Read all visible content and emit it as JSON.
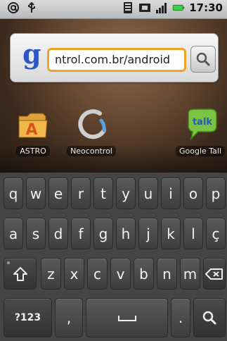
{
  "status_bar": {
    "left_icons": [
      "at-sign-icon",
      "usb-icon"
    ],
    "right_icons": [
      "sd-card-icon",
      "sim-icon",
      "signal-icon",
      "battery-icon"
    ],
    "time": "17:30"
  },
  "search": {
    "logo": "g",
    "query": "ntrol.com.br/android",
    "button_icon": "magnifier-icon"
  },
  "apps": [
    {
      "label": "ASTRO"
    },
    {
      "label": "Neocontrol"
    },
    {
      "label": "Google Tall"
    }
  ],
  "keyboard": {
    "row1": [
      "q",
      "w",
      "e",
      "r",
      "t",
      "y",
      "u",
      "i",
      "o",
      "p"
    ],
    "row2": [
      "a",
      "s",
      "d",
      "f",
      "g",
      "h",
      "j",
      "k",
      "l",
      "ç"
    ],
    "row3": [
      "z",
      "x",
      "c",
      "v",
      "b",
      "n",
      "m"
    ],
    "symbols_label": "?123",
    "comma": ",",
    "period": "."
  },
  "colors": {
    "accent_search": "#f0a32c",
    "google_blue": "#2c55c6",
    "battery_green": "#3fd14a"
  }
}
